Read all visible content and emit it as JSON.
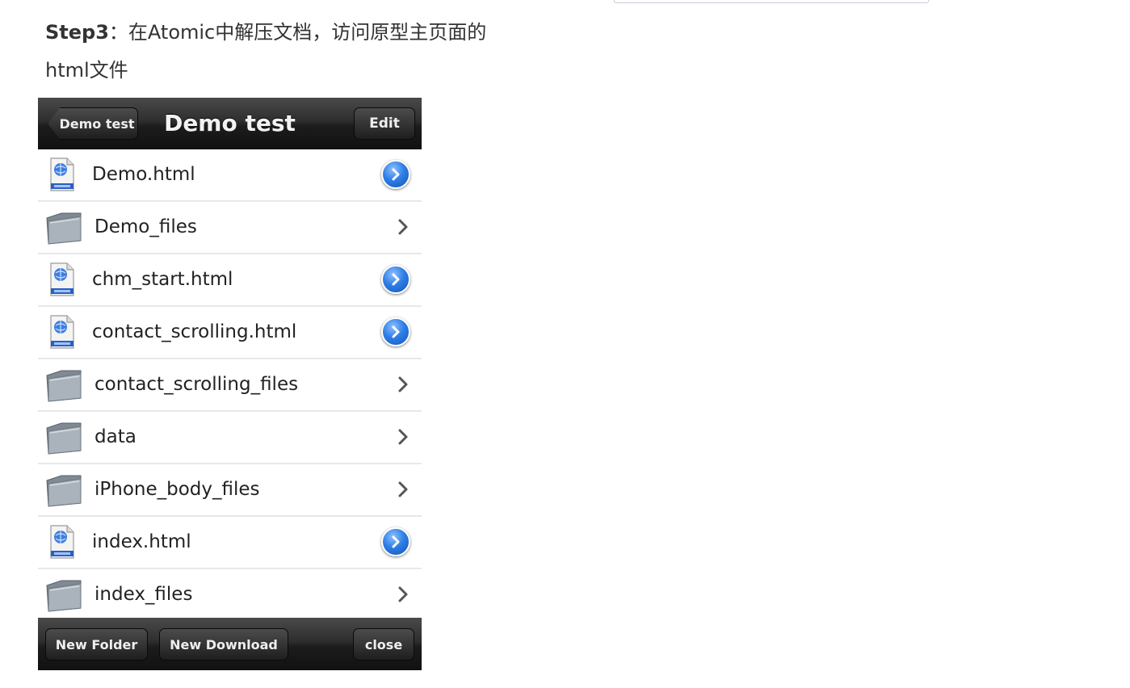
{
  "instruction": {
    "step_label": "Step3",
    "line1_text": "：在Atomic中解压文档，访问原型主页面的",
    "line2_text": "html文件"
  },
  "navbar": {
    "title": "Demo test",
    "back_label": "Demo test",
    "edit_label": "Edit"
  },
  "files": [
    {
      "name": "Demo.html",
      "type": "file",
      "accessory": "detail-disclosure"
    },
    {
      "name": "Demo_files",
      "type": "folder",
      "accessory": "chevron"
    },
    {
      "name": "chm_start.html",
      "type": "file",
      "accessory": "detail-disclosure"
    },
    {
      "name": "contact_scrolling.html",
      "type": "file",
      "accessory": "detail-disclosure"
    },
    {
      "name": "contact_scrolling_files",
      "type": "folder",
      "accessory": "chevron"
    },
    {
      "name": "data",
      "type": "folder",
      "accessory": "chevron"
    },
    {
      "name": "iPhone_body_files",
      "type": "folder",
      "accessory": "chevron"
    },
    {
      "name": "index.html",
      "type": "file",
      "accessory": "detail-disclosure"
    },
    {
      "name": "index_files",
      "type": "folder",
      "accessory": "chevron"
    }
  ],
  "toolbar": {
    "new_folder_label": "New Folder",
    "new_download_label": "New Download",
    "close_label": "close"
  },
  "colors": {
    "bar_dark": "#1c1c1c",
    "detail_blue": "#2f7fe6",
    "row_divider": "#e8e8e8"
  }
}
